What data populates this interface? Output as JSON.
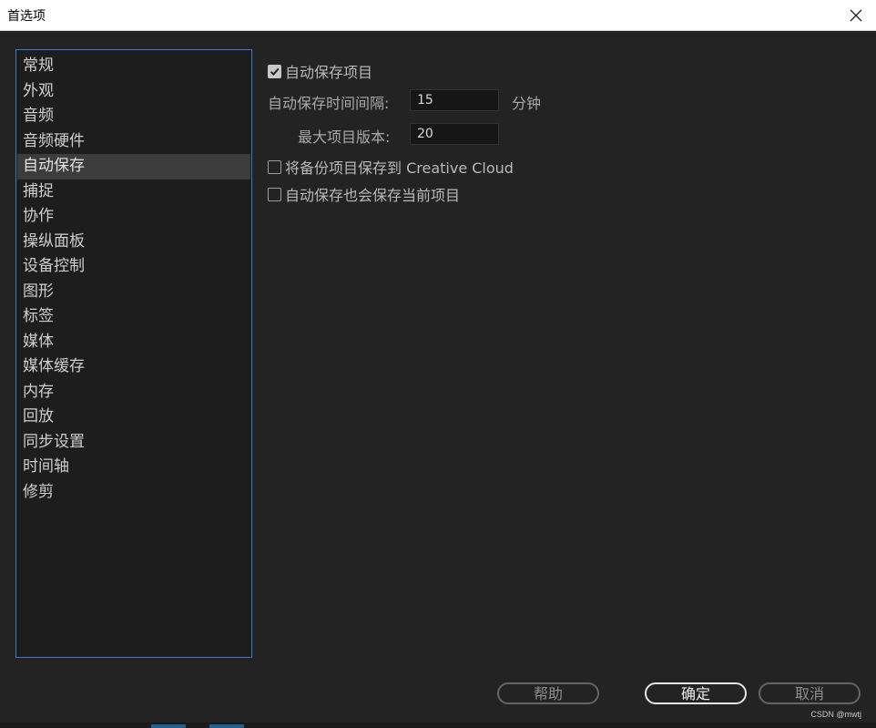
{
  "window": {
    "title": "首选项"
  },
  "sidebar": {
    "items": [
      {
        "label": "常规"
      },
      {
        "label": "外观"
      },
      {
        "label": "音频"
      },
      {
        "label": "音频硬件"
      },
      {
        "label": "自动保存",
        "selected": true
      },
      {
        "label": "捕捉"
      },
      {
        "label": "协作"
      },
      {
        "label": "操纵面板"
      },
      {
        "label": "设备控制"
      },
      {
        "label": "图形"
      },
      {
        "label": "标签"
      },
      {
        "label": "媒体"
      },
      {
        "label": "媒体缓存"
      },
      {
        "label": "内存"
      },
      {
        "label": "回放"
      },
      {
        "label": "同步设置"
      },
      {
        "label": "时间轴"
      },
      {
        "label": "修剪"
      }
    ]
  },
  "autosave": {
    "enable_label": "自动保存项目",
    "enable_checked": true,
    "interval_label": "自动保存时间间隔:",
    "interval_value": "15",
    "interval_unit": "分钟",
    "max_versions_label": "最大项目版本:",
    "max_versions_value": "20",
    "creative_cloud_label": "将备份项目保存到 Creative Cloud",
    "creative_cloud_checked": false,
    "save_current_label": "自动保存也会保存当前项目",
    "save_current_checked": false
  },
  "buttons": {
    "help": "帮助",
    "ok": "确定",
    "cancel": "取消"
  },
  "watermark": "CSDN @mwtj",
  "colors": {
    "accent_border": "#3b79c6",
    "background": "#232323",
    "selected_item": "#3c3c3c"
  }
}
